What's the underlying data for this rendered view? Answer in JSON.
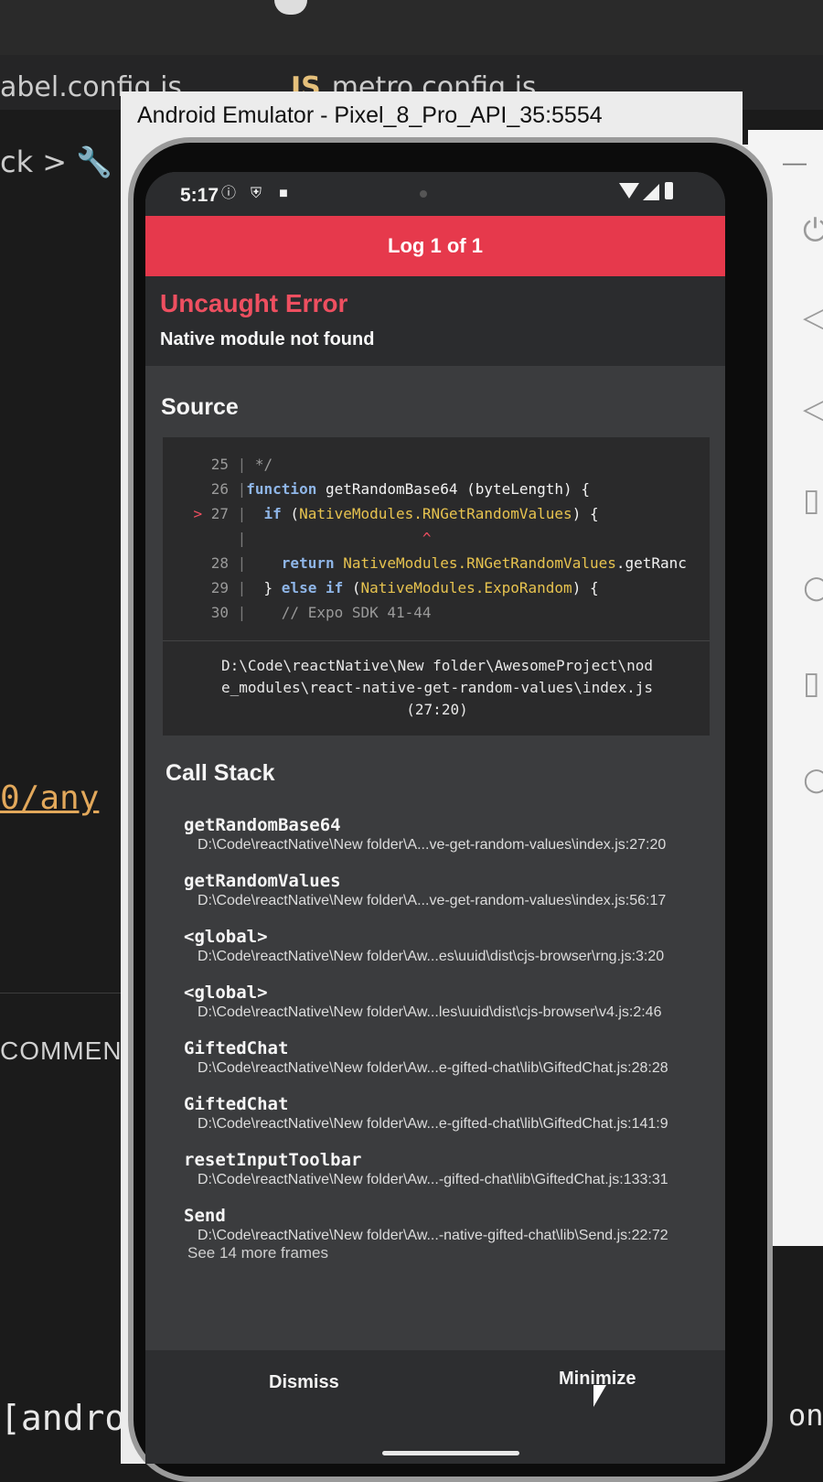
{
  "editor": {
    "tab_babel": "abel.config.js",
    "tab_metro_badge": "JS",
    "tab_metro": "metro.config.js",
    "breadcrumb": "ck >",
    "code_fragment": "0/any",
    "code_comma": "',",
    "panel_label": "COMMENTS",
    "terminal_text": "[androi",
    "right_fragment": "on"
  },
  "emulator": {
    "window_title": "Android Emulator - Pixel_8_Pro_API_35:5554",
    "side_minimize": "—"
  },
  "phone": {
    "status_time": "5:17"
  },
  "logbox": {
    "header": "Log 1 of 1",
    "error_type": "Uncaught Error",
    "error_message": "Native module not found",
    "source_title": "Source",
    "code": {
      "lines": [
        {
          "marker": "",
          "num": "25",
          "text": " */"
        },
        {
          "marker": "",
          "num": "26",
          "text": "function getRandomBase64 (byteLength) {"
        },
        {
          "marker": ">",
          "num": "27",
          "text": "  if (NativeModules.RNGetRandomValues) {"
        },
        {
          "marker": "",
          "num": "",
          "text": "                    ^"
        },
        {
          "marker": "",
          "num": "28",
          "text": "    return NativeModules.RNGetRandomValues.getRanc"
        },
        {
          "marker": "",
          "num": "29",
          "text": "  } else if (NativeModules.ExpoRandom) {"
        },
        {
          "marker": "",
          "num": "30",
          "text": "    // Expo SDK 41-44"
        }
      ],
      "file_line1": "D:\\Code\\reactNative\\New folder\\AwesomeProject\\nod",
      "file_line2": "e_modules\\react-native-get-random-values\\index.js",
      "file_line3": "(27:20)"
    },
    "call_stack_title": "Call Stack",
    "frames": [
      {
        "fn": "getRandomBase64",
        "loc": "D:\\Code\\reactNative\\New folder\\A...ve-get-random-values\\index.js:27:20"
      },
      {
        "fn": "getRandomValues",
        "loc": "D:\\Code\\reactNative\\New folder\\A...ve-get-random-values\\index.js:56:17"
      },
      {
        "fn": "<global>",
        "loc": "D:\\Code\\reactNative\\New folder\\Aw...es\\uuid\\dist\\cjs-browser\\rng.js:3:20"
      },
      {
        "fn": "<global>",
        "loc": "D:\\Code\\reactNative\\New folder\\Aw...les\\uuid\\dist\\cjs-browser\\v4.js:2:46"
      },
      {
        "fn": "GiftedChat",
        "loc": "D:\\Code\\reactNative\\New folder\\Aw...e-gifted-chat\\lib\\GiftedChat.js:28:28"
      },
      {
        "fn": "GiftedChat",
        "loc": "D:\\Code\\reactNative\\New folder\\Aw...e-gifted-chat\\lib\\GiftedChat.js:141:9"
      },
      {
        "fn": "resetInputToolbar",
        "loc": "D:\\Code\\reactNative\\New folder\\Aw...-gifted-chat\\lib\\GiftedChat.js:133:31"
      },
      {
        "fn": "Send",
        "loc": "D:\\Code\\reactNative\\New folder\\Aw...-native-gifted-chat\\lib\\Send.js:22:72"
      }
    ],
    "see_more": "See 14 more frames",
    "dismiss_label": "Dismiss",
    "minimize_label": "Minimize"
  },
  "colors": {
    "log_header_bg": "#e6394c",
    "error_title": "#ee4f60",
    "keyword": "#8fb6e8",
    "module": "#e7c34f"
  },
  "icons": [
    "wrench-icon",
    "info-circle-icon",
    "shield-icon",
    "sim-card-icon",
    "wifi-icon",
    "signal-icon",
    "battery-icon",
    "power-icon",
    "volume-up-icon",
    "volume-down-icon",
    "rotate-icon",
    "zoom-icon",
    "tablet-icon",
    "cursor-icon"
  ]
}
